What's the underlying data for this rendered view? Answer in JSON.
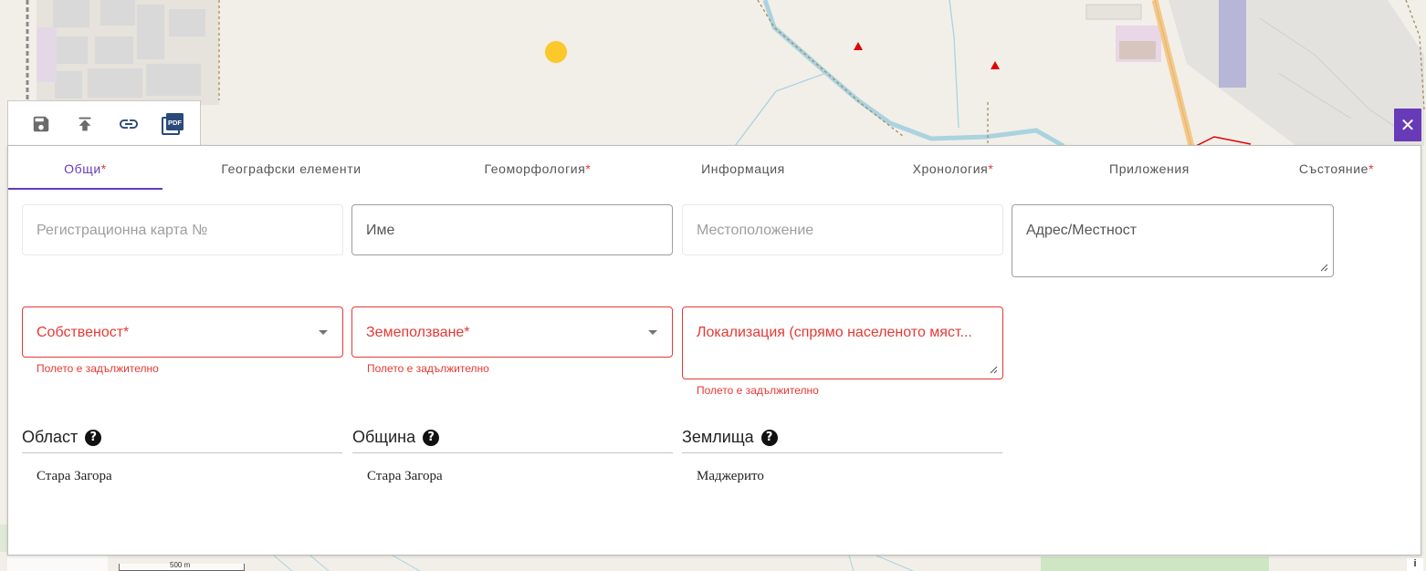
{
  "toolbar": {
    "save_icon": "save-icon",
    "upload_icon": "upload-icon",
    "link_icon": "link-icon",
    "pdf_icon": "pdf-icon",
    "pdf_text": "PDF"
  },
  "close_label": "✕",
  "tabs": [
    {
      "label": "Общи",
      "required": "*"
    },
    {
      "label": "Географски елементи",
      "required": ""
    },
    {
      "label": "Геоморфология",
      "required": "*"
    },
    {
      "label": "Информация",
      "required": ""
    },
    {
      "label": "Хронология",
      "required": "*"
    },
    {
      "label": "Приложения",
      "required": ""
    },
    {
      "label": "Състояние",
      "required": "*"
    }
  ],
  "fields": {
    "reg_card": {
      "placeholder": "Регистрационна карта №"
    },
    "name": {
      "placeholder": "Име"
    },
    "location": {
      "placeholder": "Местоположение"
    },
    "address": {
      "placeholder": "Адрес/Местност"
    },
    "ownership": {
      "placeholder": "Собственост*",
      "error": "Полето е задължително"
    },
    "land_use": {
      "placeholder": "Земеползване*",
      "error": "Полето е задължително"
    },
    "localization": {
      "placeholder": "Локализация (спрямо населеното място)",
      "display": "Локализация (спрямо населеното мяст...",
      "error": "Полето е задължително"
    }
  },
  "region": {
    "label": "Област",
    "value": "Стара Загора"
  },
  "municipality": {
    "label": "Община",
    "value": "Стара Загора"
  },
  "land": {
    "label": "Землища",
    "value": "Маджерито"
  },
  "help_glyph": "?",
  "map": {
    "scale_label": "500 m",
    "info_glyph": "i"
  },
  "colors": {
    "accent": "#673ab7",
    "error": "#e53935"
  }
}
